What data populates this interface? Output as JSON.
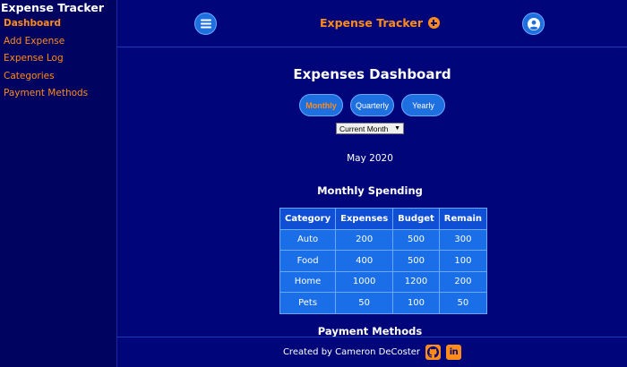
{
  "sidebar": {
    "brand": "Expense Tracker",
    "items": [
      {
        "label": "Dashboard",
        "active": true
      },
      {
        "label": "Add Expense",
        "active": false
      },
      {
        "label": "Expense Log",
        "active": false
      },
      {
        "label": "Categories",
        "active": false
      },
      {
        "label": "Payment Methods",
        "active": false
      }
    ]
  },
  "topbar": {
    "title": "Expense Tracker",
    "menu_icon": "hamburger-icon",
    "add_icon": "plus-circle-icon",
    "user_icon": "user-circle-icon"
  },
  "page": {
    "title": "Expenses Dashboard",
    "tabs": [
      {
        "label": "Monthly",
        "active": true
      },
      {
        "label": "Quarterly",
        "active": false
      },
      {
        "label": "Yearly",
        "active": false
      }
    ],
    "period_select": "Current Month",
    "date_label": "May 2020",
    "spending_title": "Monthly Spending",
    "payment_title": "Payment Methods"
  },
  "table": {
    "headers": [
      "Category",
      "Expenses",
      "Budget",
      "Remain"
    ],
    "rows": [
      [
        "Auto",
        "200",
        "500",
        "300"
      ],
      [
        "Food",
        "400",
        "500",
        "100"
      ],
      [
        "Home",
        "1000",
        "1200",
        "200"
      ],
      [
        "Pets",
        "50",
        "100",
        "50"
      ]
    ]
  },
  "footer": {
    "credit": "Created by Cameron DeCoster",
    "github_icon": "github-icon",
    "linkedin_icon": "linkedin-icon",
    "linkedin_text": "in"
  },
  "colors": {
    "background": "#00057a",
    "sidebar": "#00035f",
    "accent": "#ff8c1a",
    "button": "#1e6fe0"
  }
}
